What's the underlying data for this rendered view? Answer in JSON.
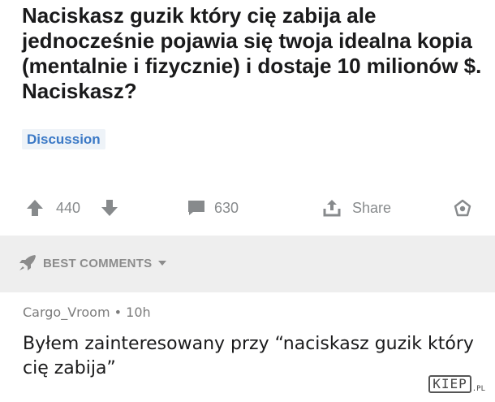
{
  "post": {
    "title": "Naciskasz guzik który cię zabija ale jednocześnie pojawia się twoja idealna kopia (mentalnie i fizycznie) i dostaje 10 milionów $. Naciskasz?",
    "flair": "Discussion",
    "score": "440",
    "comments_count": "630",
    "share_label": "Share"
  },
  "sort": {
    "label": "BEST COMMENTS"
  },
  "comment": {
    "meta": "Cargo_Vroom • 10h",
    "body": "Byłem zainteresowany przy “naciskasz guzik który cię zabija”"
  },
  "watermark": {
    "main": "KIEP",
    "suffix": ".PL"
  },
  "colors": {
    "flair_bg": "#eef3f8",
    "flair_text": "#3b79c6",
    "icon_gray": "#878a8c",
    "band": "#eeeeee"
  }
}
